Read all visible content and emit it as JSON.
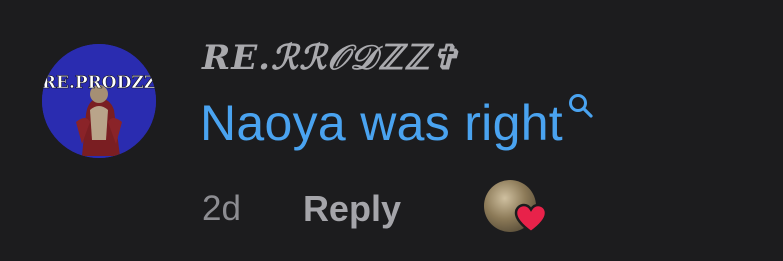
{
  "comment": {
    "username": "RE.ℛℛ𝒪𝒟ℤℤ✞",
    "text": "Naoya was right",
    "timestamp": "2d",
    "reply_label": "Reply"
  },
  "avatar": {
    "logo_text": "RE.PRODZZ"
  },
  "icons": {
    "inline": "search-icon",
    "liked_by": "heart-icon"
  },
  "colors": {
    "background": "#1c1c1e",
    "comment_text": "#4aa3f0",
    "heart": "#e8224a"
  }
}
